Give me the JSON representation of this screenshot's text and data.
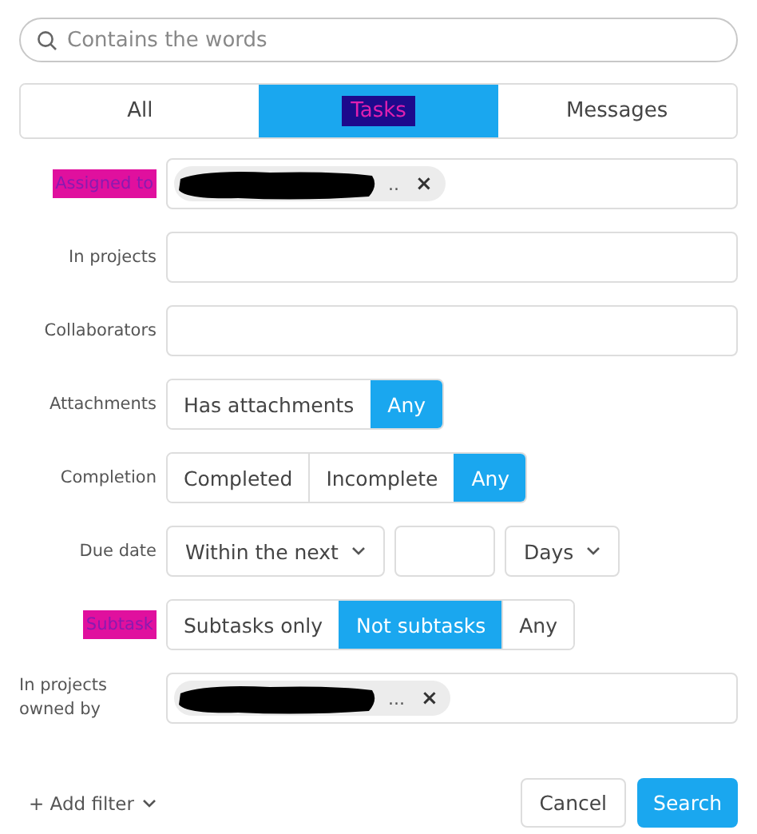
{
  "search": {
    "placeholder": "Contains the words"
  },
  "tabs": [
    {
      "label": "All",
      "selected": false,
      "highlighted": false
    },
    {
      "label": "Tasks",
      "selected": true,
      "highlighted": true
    },
    {
      "label": "Messages",
      "selected": false,
      "highlighted": false
    }
  ],
  "filters": [
    {
      "kind": "chips",
      "label": "Assigned to",
      "highlighted": true,
      "chips": [
        {
          "text": "..",
          "redacted": true,
          "remove": "×"
        }
      ]
    },
    {
      "kind": "text",
      "label": "In projects",
      "highlighted": false
    },
    {
      "kind": "text",
      "label": "Collaborators",
      "highlighted": false
    },
    {
      "kind": "segmented",
      "label": "Attachments",
      "highlighted": false,
      "options": [
        {
          "label": "Has attachments",
          "selected": false
        },
        {
          "label": "Any",
          "selected": true
        }
      ]
    },
    {
      "kind": "segmented",
      "label": "Completion",
      "highlighted": false,
      "options": [
        {
          "label": "Completed",
          "selected": false
        },
        {
          "label": "Incomplete",
          "selected": false
        },
        {
          "label": "Any",
          "selected": true
        }
      ]
    },
    {
      "kind": "due",
      "label": "Due date",
      "highlighted": false,
      "range": "Within the next",
      "unit": "Days"
    },
    {
      "kind": "segmented",
      "label": "Subtask",
      "highlighted": true,
      "options": [
        {
          "label": "Subtasks only",
          "selected": false
        },
        {
          "label": "Not subtasks",
          "selected": true
        },
        {
          "label": "Any",
          "selected": false
        }
      ]
    },
    {
      "kind": "chips",
      "label": "In projects owned by",
      "highlighted": false,
      "chips": [
        {
          "text": "...",
          "redacted": true,
          "remove": "×"
        }
      ]
    }
  ],
  "footer": {
    "add_filter": "+ Add filter",
    "cancel": "Cancel",
    "search": "Search"
  }
}
